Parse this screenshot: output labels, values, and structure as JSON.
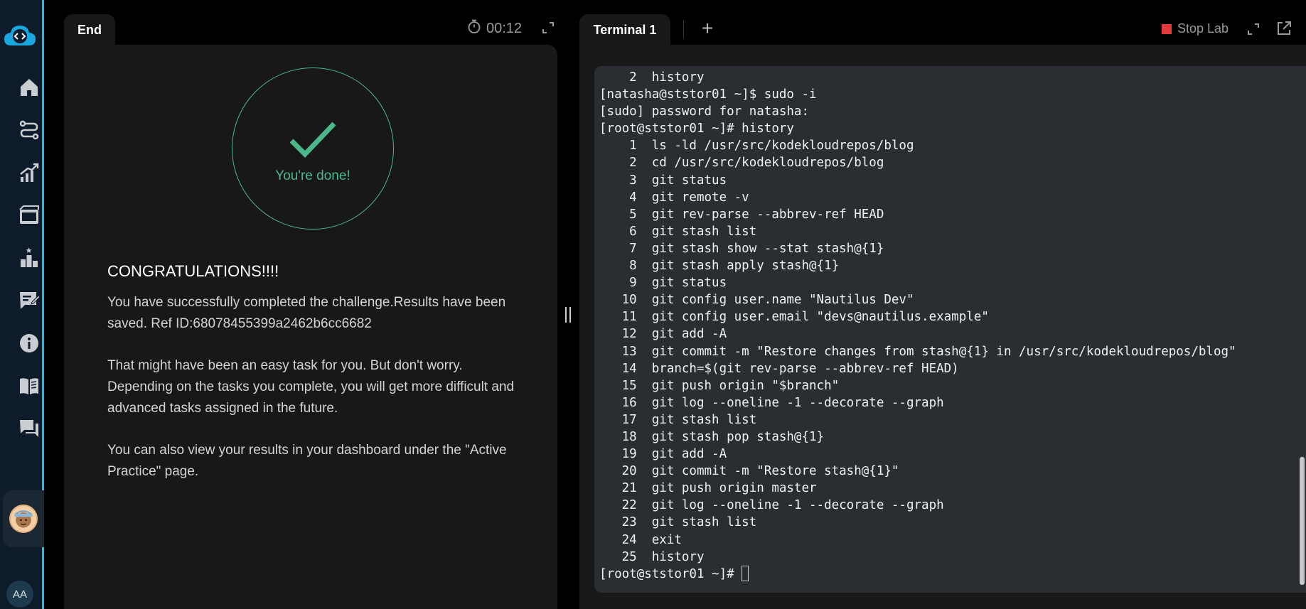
{
  "sidebar": {
    "items": [
      {
        "icon": "home-icon"
      },
      {
        "icon": "path-icon"
      },
      {
        "icon": "growth-chart-icon"
      },
      {
        "icon": "film-icon"
      },
      {
        "icon": "leaderboard-icon"
      },
      {
        "icon": "edit-note-icon"
      },
      {
        "icon": "info-icon"
      },
      {
        "icon": "book-icon"
      },
      {
        "icon": "chat-icon"
      }
    ],
    "user_initials": "AA"
  },
  "left_panel": {
    "tab_label": "End",
    "timer": "00:12",
    "done_text": "You're done!",
    "heading": "CONGRATULATIONS!!!!",
    "paragraphs": [
      "You have successfully completed the challenge.Results have been saved. Ref ID:68078455399a2462b6cc6682",
      "That might have been an easy task for you. But don't worry. Depending on the tasks you complete, you will get more difficult and advanced tasks assigned in the future.",
      "You can also view your results in your dashboard under the \"Active Practice\" page."
    ]
  },
  "terminal": {
    "tab_label": "Terminal 1",
    "add_tab": "+",
    "stop_label": "Stop Lab",
    "colors": {
      "stop": "#e33b3b",
      "success": "#4bb88b",
      "accent": "#2bb6e6"
    },
    "lines": [
      "    2  history",
      "[natasha@ststor01 ~]$ sudo -i",
      "[sudo] password for natasha:",
      "[root@ststor01 ~]# history",
      "    1  ls -ld /usr/src/kodekloudrepos/blog",
      "    2  cd /usr/src/kodekloudrepos/blog",
      "    3  git status",
      "    4  git remote -v",
      "    5  git rev-parse --abbrev-ref HEAD",
      "    6  git stash list",
      "    7  git stash show --stat stash@{1}",
      "    8  git stash apply stash@{1}",
      "    9  git status",
      "   10  git config user.name \"Nautilus Dev\"",
      "   11  git config user.email \"devs@nautilus.example\"",
      "   12  git add -A",
      "   13  git commit -m \"Restore changes from stash@{1} in /usr/src/kodekloudrepos/blog\"",
      "   14  branch=$(git rev-parse --abbrev-ref HEAD)",
      "   15  git push origin \"$branch\"",
      "   16  git log --oneline -1 --decorate --graph",
      "   17  git stash list",
      "   18  git stash pop stash@{1}",
      "   19  git add -A",
      "   20  git commit -m \"Restore stash@{1}\"",
      "   21  git push origin master",
      "   22  git log --oneline -1 --decorate --graph",
      "   23  git stash list",
      "   24  exit",
      "   25  history"
    ],
    "prompt": "[root@ststor01 ~]# "
  }
}
